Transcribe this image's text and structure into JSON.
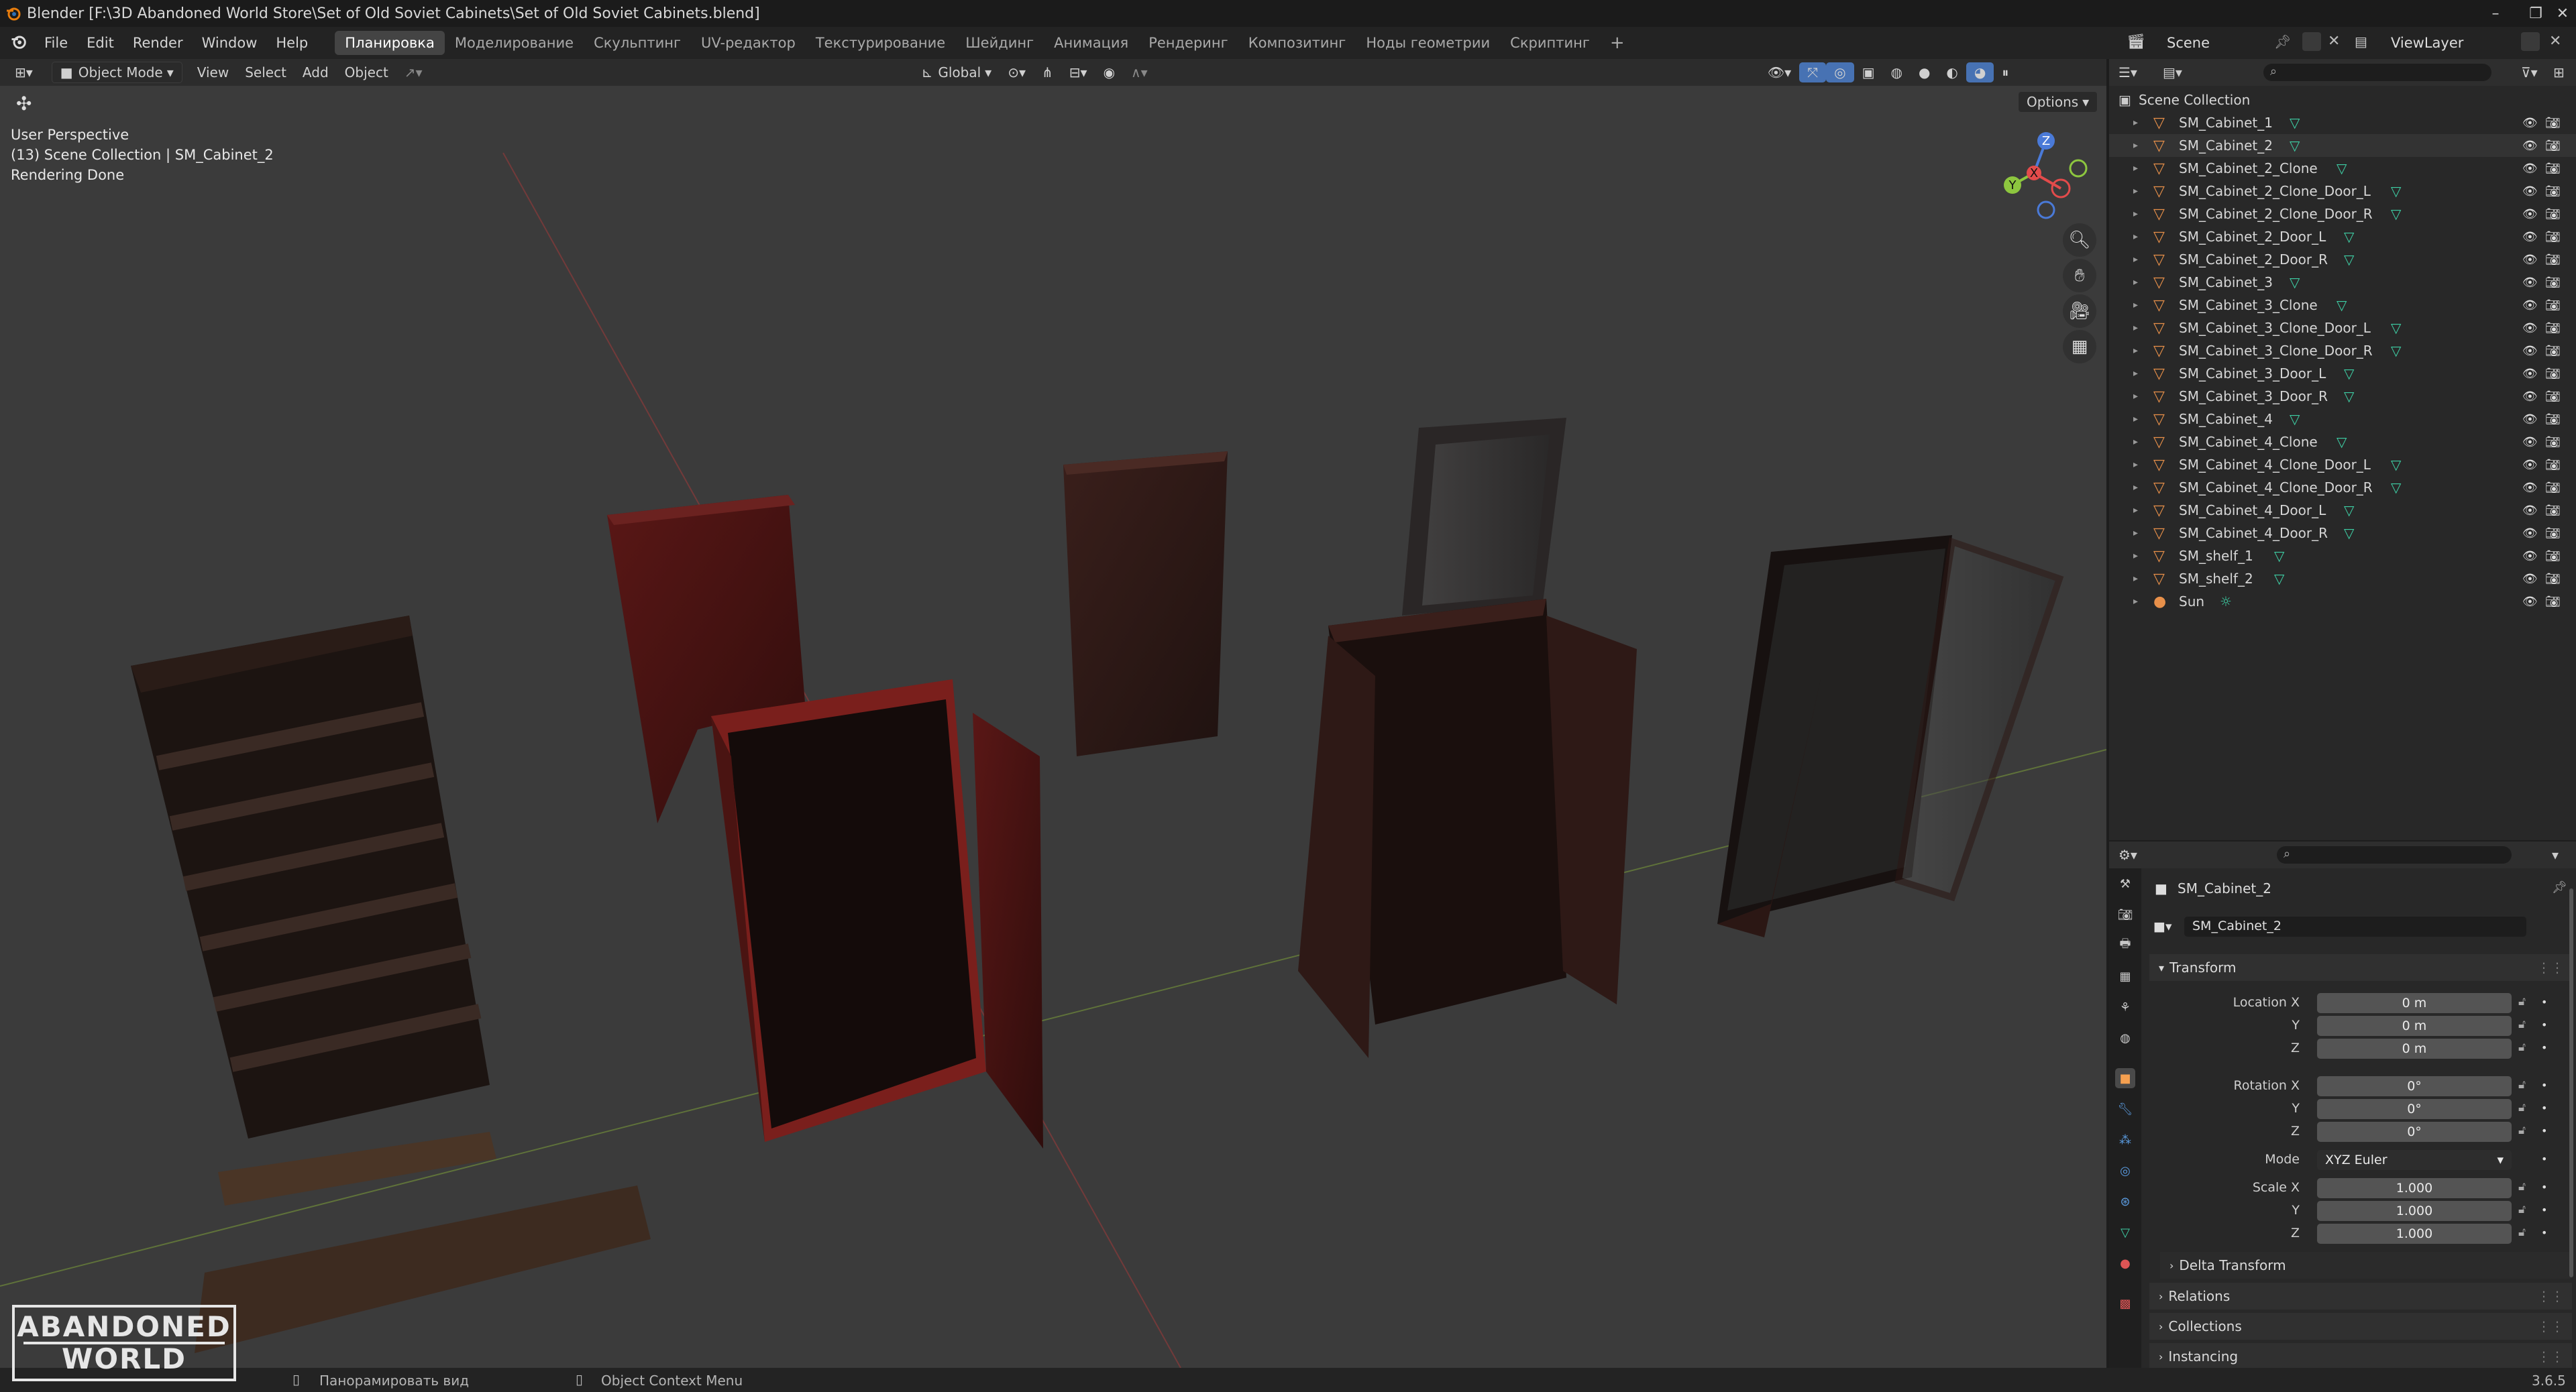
{
  "window": {
    "title": "Blender [F:\\3D Abandoned World Store\\Set of Old Soviet Cabinets\\Set of Old Soviet Cabinets.blend]"
  },
  "menu": [
    "File",
    "Edit",
    "Render",
    "Window",
    "Help"
  ],
  "workspaces": {
    "tabs": [
      "Планировка",
      "Моделирование",
      "Скульптинг",
      "UV-редактор",
      "Текстурирование",
      "Шейдинг",
      "Анимация",
      "Рендеринг",
      "Композитинг",
      "Ноды геометрии",
      "Скриптинг"
    ],
    "active_index": 0,
    "add": "+"
  },
  "scene": {
    "name": "Scene",
    "view_layer": "ViewLayer"
  },
  "viewport": {
    "mode": "Object Mode",
    "menus": [
      "View",
      "Select",
      "Add",
      "Object"
    ],
    "orientation": "Global",
    "options": "Options",
    "overlay_lines": [
      "User Perspective",
      "(13) Scene Collection | SM_Cabinet_2",
      "Rendering Done"
    ],
    "gizmo": {
      "x": "X",
      "y": "Y",
      "z": "Z"
    }
  },
  "outliner": {
    "root": "Scene Collection",
    "items": [
      "SM_Cabinet_1",
      "SM_Cabinet_2",
      "SM_Cabinet_2_Clone",
      "SM_Cabinet_2_Clone_Door_L",
      "SM_Cabinet_2_Clone_Door_R",
      "SM_Cabinet_2_Door_L",
      "SM_Cabinet_2_Door_R",
      "SM_Cabinet_3",
      "SM_Cabinet_3_Clone",
      "SM_Cabinet_3_Clone_Door_L",
      "SM_Cabinet_3_Clone_Door_R",
      "SM_Cabinet_3_Door_L",
      "SM_Cabinet_3_Door_R",
      "SM_Cabinet_4",
      "SM_Cabinet_4_Clone",
      "SM_Cabinet_4_Clone_Door_L",
      "SM_Cabinet_4_Clone_Door_R",
      "SM_Cabinet_4_Door_L",
      "SM_Cabinet_4_Door_R",
      "SM_shelf_1",
      "SM_shelf_2",
      "Sun"
    ]
  },
  "properties": {
    "object_name": "SM_Cabinet_2",
    "data_name": "SM_Cabinet_2",
    "transform": {
      "title": "Transform",
      "location_label": "Location X",
      "y_label": "Y",
      "z_label": "Z",
      "location": [
        "0 m",
        "0 m",
        "0 m"
      ],
      "rotation_label": "Rotation X",
      "rotation": [
        "0°",
        "0°",
        "0°"
      ],
      "mode_label": "Mode",
      "mode": "XYZ Euler",
      "scale_label": "Scale X",
      "scale": [
        "1.000",
        "1.000",
        "1.000"
      ]
    },
    "panels": [
      "Delta Transform",
      "Relations",
      "Collections",
      "Instancing"
    ]
  },
  "statusbar": {
    "pan": "Панорамировать вид",
    "context": "Object Context Menu",
    "version": "3.6.5"
  },
  "logo": {
    "line1": "ABANDONED",
    "line2": "WORLD"
  },
  "colors": {
    "accent": "#4772b3",
    "object_icon": "#e8904a",
    "mesh_icon": "#3ecfa5",
    "viewport_bg": "#3b3b3b"
  }
}
